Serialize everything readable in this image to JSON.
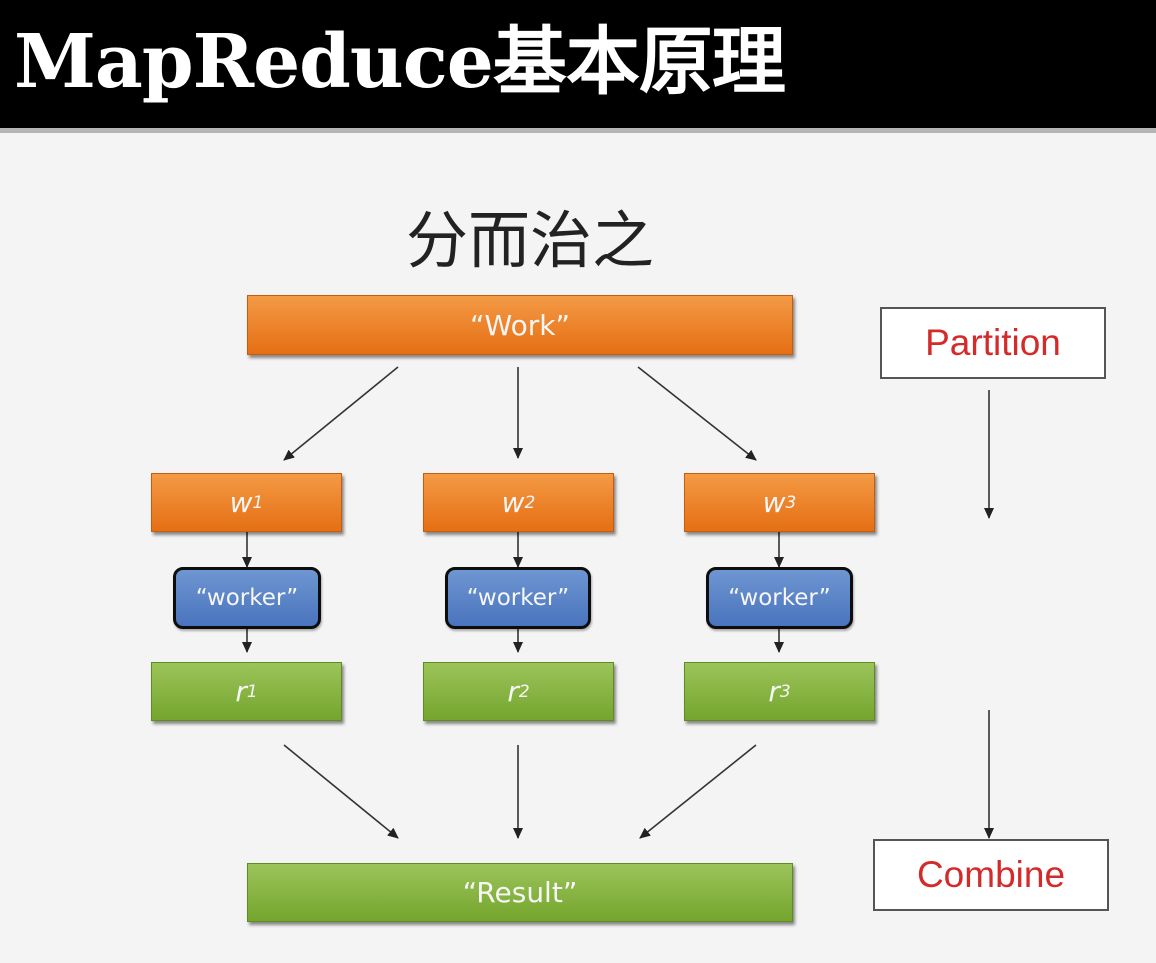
{
  "header": {
    "title": "MapReduce基本原理"
  },
  "diagram": {
    "title": "分而治之",
    "work": "“Work”",
    "result": "“Result”",
    "work_units": [
      {
        "base": "w",
        "sub": "1"
      },
      {
        "base": "w",
        "sub": "2"
      },
      {
        "base": "w",
        "sub": "3"
      }
    ],
    "workers": [
      "“worker”",
      "“worker”",
      "“worker”"
    ],
    "results": [
      {
        "base": "r",
        "sub": "1"
      },
      {
        "base": "r",
        "sub": "2"
      },
      {
        "base": "r",
        "sub": "3"
      }
    ],
    "partition_label": "Partition",
    "combine_label": "Combine"
  },
  "colors": {
    "header_bg": "#000000",
    "orange": "#ec8224",
    "green": "#86b342",
    "blue": "#5a84c8",
    "label_text": "#d42a2a"
  }
}
